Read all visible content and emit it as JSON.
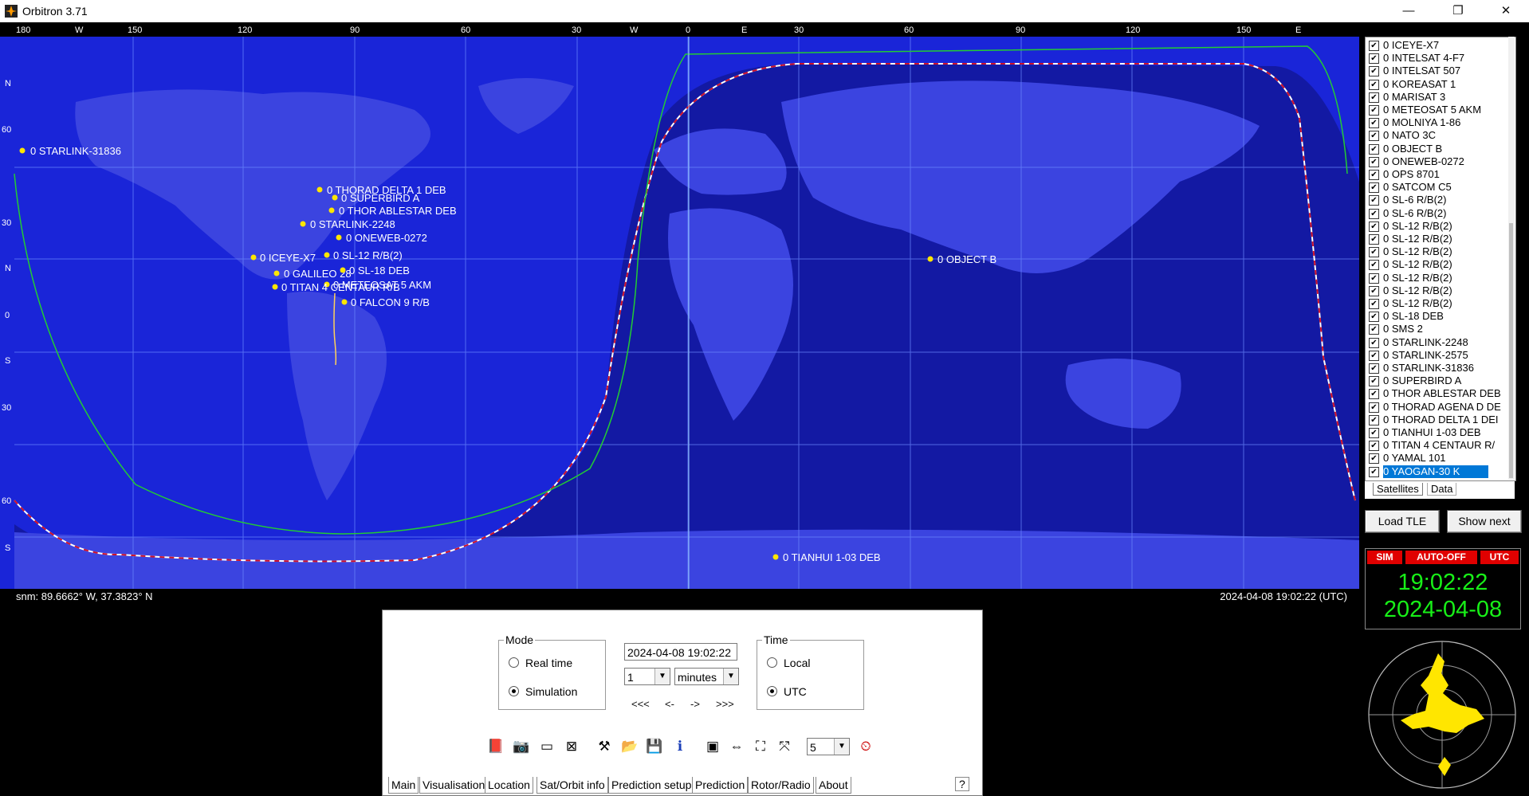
{
  "window": {
    "title": "Orbitron 3.71",
    "minimize": "—",
    "maximize": "❐",
    "close": "✕"
  },
  "map": {
    "top_ticks": [
      {
        "label": "180"
      },
      {
        "label": "W"
      },
      {
        "label": "150"
      },
      {
        "label": "120"
      },
      {
        "label": "90"
      },
      {
        "label": "60"
      },
      {
        "label": "30"
      },
      {
        "label": "W"
      },
      {
        "label": "0"
      },
      {
        "label": "E"
      },
      {
        "label": "30"
      },
      {
        "label": "60"
      },
      {
        "label": "90"
      },
      {
        "label": "120"
      },
      {
        "label": "150"
      },
      {
        "label": "E"
      }
    ],
    "left_ticks": [
      {
        "label": "N"
      },
      {
        "label": "60"
      },
      {
        "label": "30"
      },
      {
        "label": "N"
      },
      {
        "label": "0"
      },
      {
        "label": "S"
      },
      {
        "label": "30"
      },
      {
        "label": "60"
      },
      {
        "label": "S"
      }
    ],
    "satellites": [
      {
        "label": "0 STARLINK-31836"
      },
      {
        "label": "0 THORAD DELTA 1 DEB"
      },
      {
        "label": "0 SUPERBIRD A"
      },
      {
        "label": "0 THOR ABLESTAR DEB"
      },
      {
        "label": "0 STARLINK-2248"
      },
      {
        "label": "0 ONEWEB-0272"
      },
      {
        "label": "0 SL-12 R/B(2)"
      },
      {
        "label": "0 ICEYE-X7"
      },
      {
        "label": "0 GALILEO 28"
      },
      {
        "label": "0 SL-18 DEB"
      },
      {
        "label": "0 METEOSAT 5 AKM"
      },
      {
        "label": "0 TITAN 4 CENTAUR R/B"
      },
      {
        "label": "0 FALCON 9 R/B"
      },
      {
        "label": "0 OBJECT B"
      },
      {
        "label": "0 TIANHUI 1-03 DEB"
      }
    ],
    "coordinates": "snm: 89.6662° W, 37.3823° N",
    "datetime": "2024-04-08 19:02:22 (UTC)"
  },
  "sat_list": {
    "items": [
      {
        "name": "0 ICEYE-X7",
        "checked": true
      },
      {
        "name": "0 INTELSAT 4-F7",
        "checked": true
      },
      {
        "name": "0 INTELSAT 507",
        "checked": true
      },
      {
        "name": "0 KOREASAT 1",
        "checked": true
      },
      {
        "name": "0 MARISAT 3",
        "checked": true
      },
      {
        "name": "0 METEOSAT 5 AKM",
        "checked": true
      },
      {
        "name": "0 MOLNIYA 1-86",
        "checked": true
      },
      {
        "name": "0 NATO 3C",
        "checked": true
      },
      {
        "name": "0 OBJECT B",
        "checked": true
      },
      {
        "name": "0 ONEWEB-0272",
        "checked": true
      },
      {
        "name": "0 OPS 8701",
        "checked": true
      },
      {
        "name": "0 SATCOM C5",
        "checked": true
      },
      {
        "name": "0 SL-6 R/B(2)",
        "checked": true
      },
      {
        "name": "0 SL-6 R/B(2)",
        "checked": true
      },
      {
        "name": "0 SL-12 R/B(2)",
        "checked": true
      },
      {
        "name": "0 SL-12 R/B(2)",
        "checked": true
      },
      {
        "name": "0 SL-12 R/B(2)",
        "checked": true
      },
      {
        "name": "0 SL-12 R/B(2)",
        "checked": true
      },
      {
        "name": "0 SL-12 R/B(2)",
        "checked": true
      },
      {
        "name": "0 SL-12 R/B(2)",
        "checked": true
      },
      {
        "name": "0 SL-12 R/B(2)",
        "checked": true
      },
      {
        "name": "0 SL-18 DEB",
        "checked": true
      },
      {
        "name": "0 SMS 2",
        "checked": true
      },
      {
        "name": "0 STARLINK-2248",
        "checked": true
      },
      {
        "name": "0 STARLINK-2575",
        "checked": true
      },
      {
        "name": "0 STARLINK-31836",
        "checked": true
      },
      {
        "name": "0 SUPERBIRD A",
        "checked": true
      },
      {
        "name": "0 THOR ABLESTAR DEB",
        "checked": true
      },
      {
        "name": "0 THORAD AGENA D DE",
        "checked": true
      },
      {
        "name": "0 THORAD DELTA 1 DEI",
        "checked": true
      },
      {
        "name": "0 TIANHUI 1-03 DEB",
        "checked": true
      },
      {
        "name": "0 TITAN 4 CENTAUR R/",
        "checked": true
      },
      {
        "name": "0 YAMAL 101",
        "checked": true
      },
      {
        "name": "0 YAOGAN-30 K",
        "checked": true,
        "selected": true
      }
    ],
    "tabs": [
      "Satellites",
      "Data"
    ],
    "load_tle": "Load TLE",
    "show_next": "Show next"
  },
  "status": {
    "sim": "SIM",
    "auto": "AUTO-OFF",
    "utc": "UTC",
    "time": "19:02:22",
    "date": "2024-04-08"
  },
  "controls": {
    "mode_label": "Mode",
    "real_time": "Real time",
    "simulation": "Simulation",
    "mode_selected": "simulation",
    "datetime_value": "2024-04-08 19:02:22",
    "step_value": "1",
    "step_unit": "minutes",
    "steps": [
      "<<<",
      "<-",
      "->",
      ">>>"
    ],
    "time_label": "Time",
    "local": "Local",
    "utc": "UTC",
    "time_selected": "utc",
    "count_value": "5",
    "help": "?"
  },
  "toolbar_icons": [
    "book-icon",
    "camera-icon",
    "window-icon",
    "close-window-icon",
    "tools-icon",
    "open-folder-icon",
    "save-icon",
    "info-icon",
    "map-icon",
    "resize-icon",
    "fullscreen-icon",
    "expand-icon",
    "clock-icon"
  ],
  "bottom_tabs": [
    "Main",
    "Visualisation",
    "Location",
    "Sat/Orbit info",
    "Prediction setup",
    "Prediction",
    "Rotor/Radio",
    "About"
  ],
  "colors": {
    "map_blue": "#1a25d8",
    "night_blue": "#13189a",
    "land": "#3b44e0",
    "star_yellow": "#ffe600",
    "clock_green": "#18f018",
    "badge_red": "#e00000",
    "sunlight_line": "#22cc33"
  }
}
